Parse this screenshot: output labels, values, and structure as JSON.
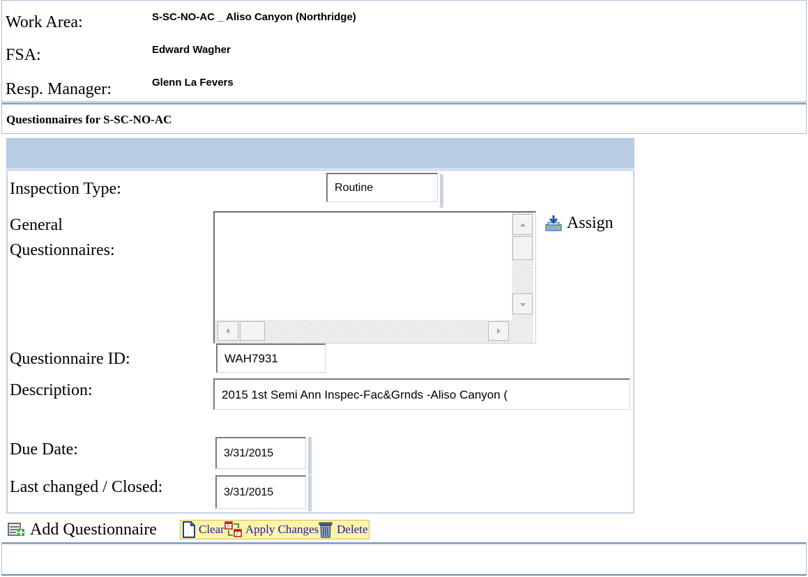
{
  "header": {
    "work_area_label": "Work Area:",
    "work_area_value": "S-SC-NO-AC _ Aliso Canyon (Northridge)",
    "fsa_label": "FSA:",
    "fsa_value": "Edward Wagher",
    "manager_label": "Resp. Manager:",
    "manager_value": "Glenn La Fevers"
  },
  "section": {
    "title": "Questionnaires for S-SC-NO-AC"
  },
  "form": {
    "inspection_type_label": "Inspection Type:",
    "inspection_type_value": "Routine",
    "general_label_line1": "General",
    "general_label_line2": "Questionnaires:",
    "assign_label": "Assign",
    "questionnaire_id_label": "Questionnaire ID:",
    "questionnaire_id_value": "WAH7931",
    "description_label": "Description:",
    "description_value": "2015 1st Semi Ann Inspec-Fac&Grnds -Aliso Canyon (",
    "due_date_label": "Due Date:",
    "due_date_value": "3/31/2015",
    "last_changed_label": "Last changed / Closed:",
    "last_changed_value": "3/31/2015"
  },
  "toolbar": {
    "add_label": "Add Questionnaire",
    "clear_label": "Clear",
    "apply_label": "Apply Changes",
    "delete_label": "Delete"
  },
  "icons": {
    "assign": "assign-icon",
    "add": "add-questionnaire-icon",
    "clear": "clear-document-icon",
    "apply": "apply-changes-icon",
    "delete": "trash-icon"
  },
  "colors": {
    "panel_border": "#a9bfd6",
    "band": "#b8cde4",
    "toolbar_highlight": "#fff3a8",
    "link": "#1a1a9c"
  }
}
